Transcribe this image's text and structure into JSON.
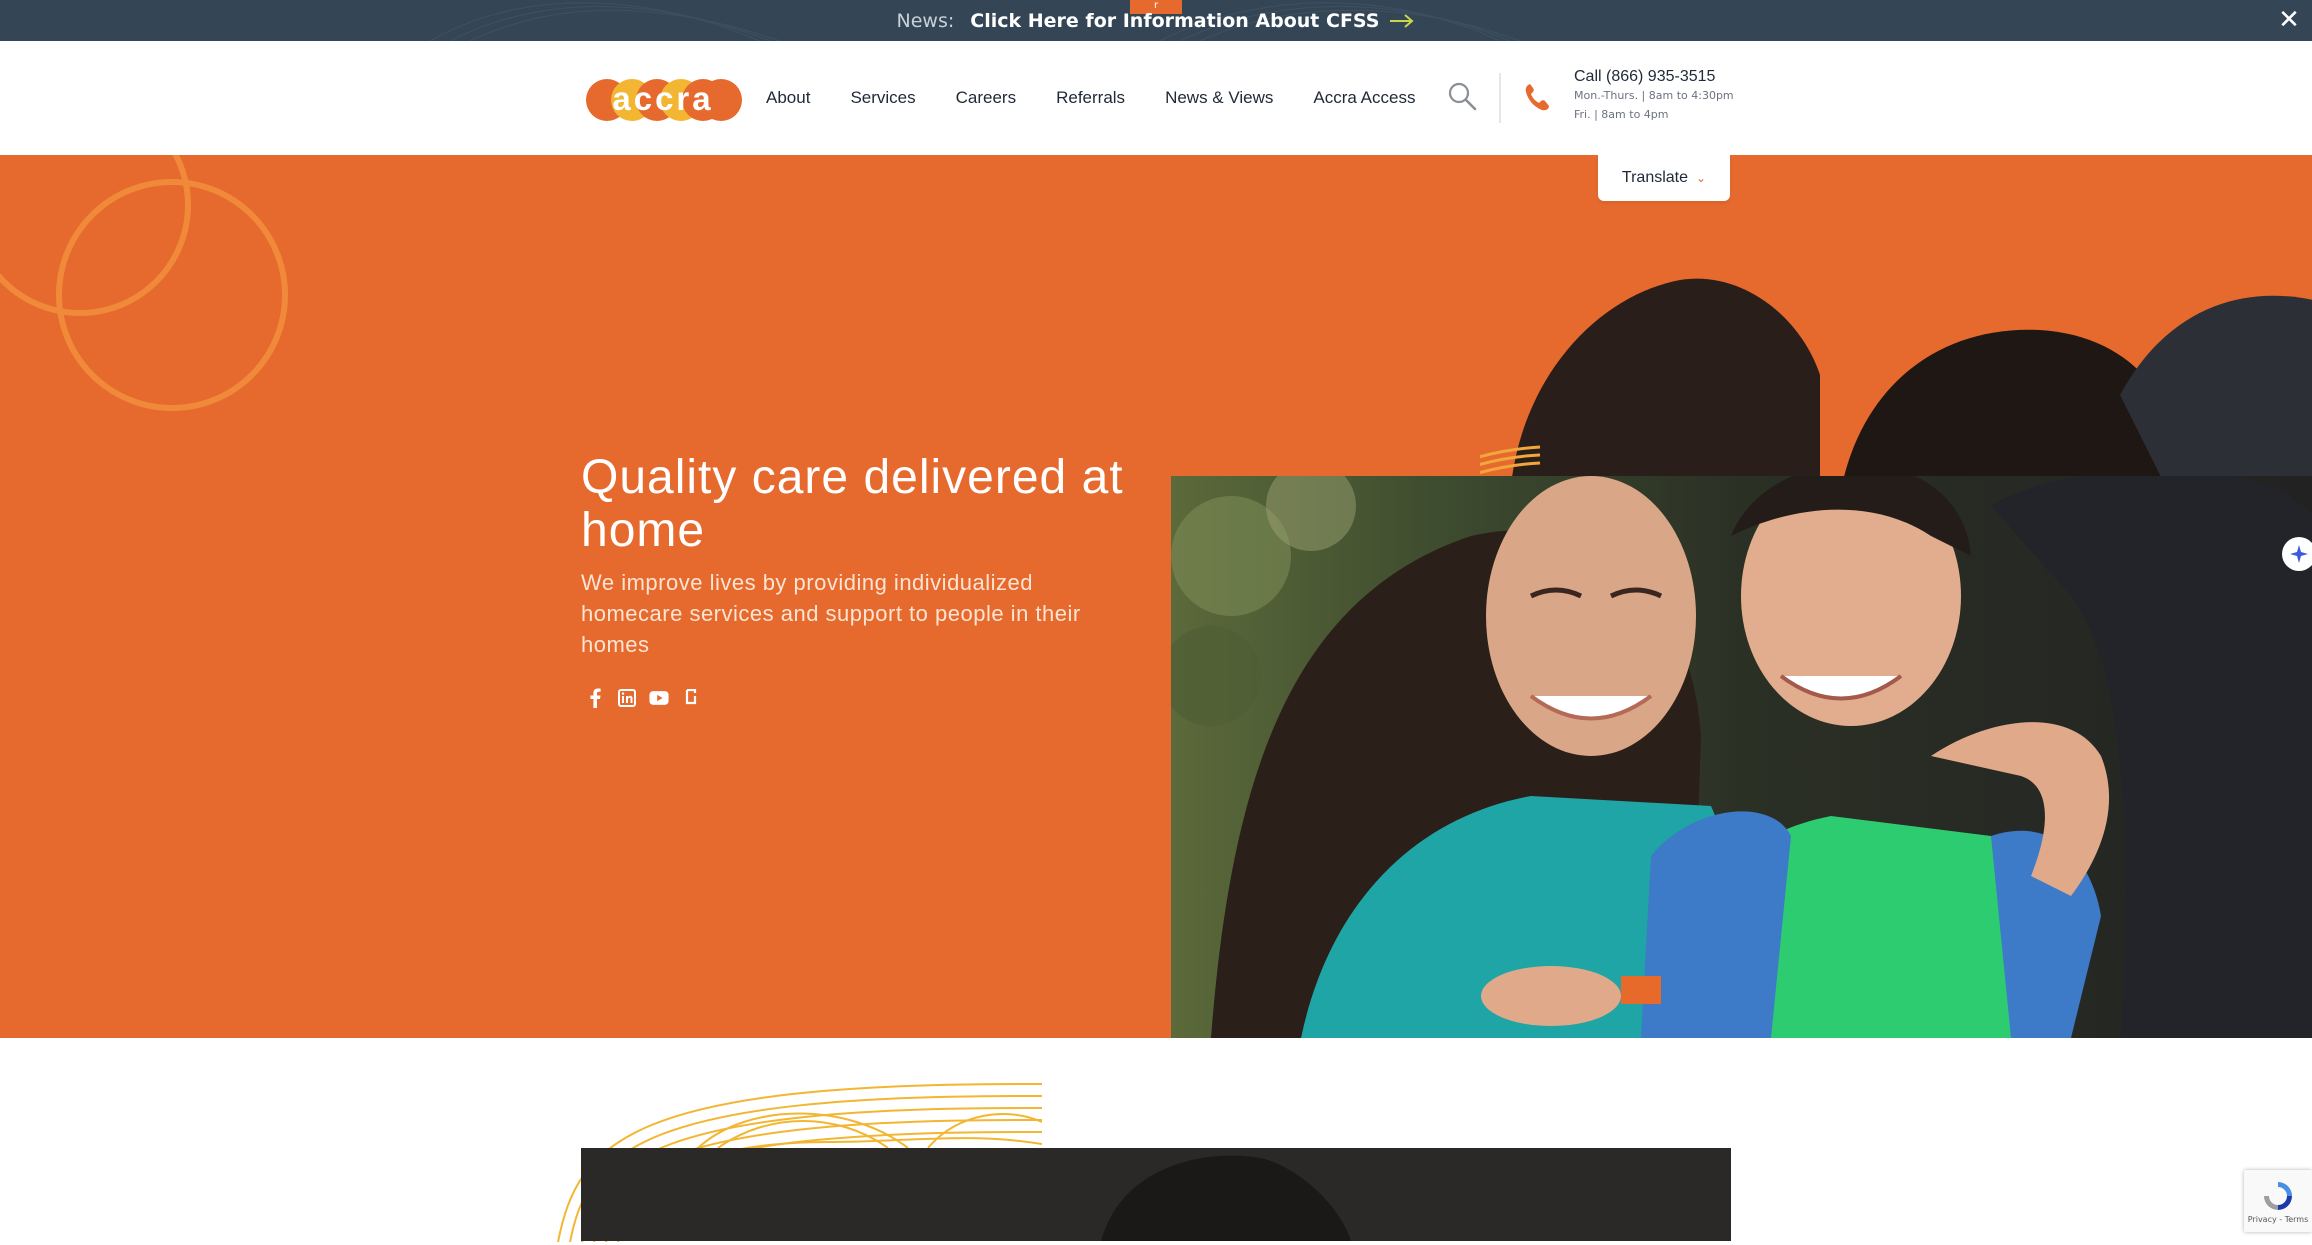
{
  "newsbar": {
    "label": "News:",
    "link_text": "Click Here for Information About CFSS",
    "tab_marker": "r",
    "close_glyph": "✕"
  },
  "header": {
    "logo_text": "accra",
    "nav": [
      "About",
      "Services",
      "Careers",
      "Referrals",
      "News & Views",
      "Accra Access"
    ],
    "call_main": "Call (866) 935-3515",
    "hours": [
      "Mon.-Thurs. | 8am to 4:30pm",
      "Fri. | 8am to 4pm"
    ]
  },
  "hero": {
    "translate_label": "Translate",
    "title": "Quality care delivered at home",
    "subtitle": "We improve lives by providing individualized homecare services and support to people in their homes",
    "socials": [
      "facebook-icon",
      "linkedin-icon",
      "youtube-icon",
      "glassdoor-icon"
    ]
  },
  "recaptcha": {
    "text": "Privacy - Terms"
  },
  "colors": {
    "brand_orange": "#e66a2e",
    "navy": "#344656",
    "accent_yellow": "#f2b632"
  }
}
